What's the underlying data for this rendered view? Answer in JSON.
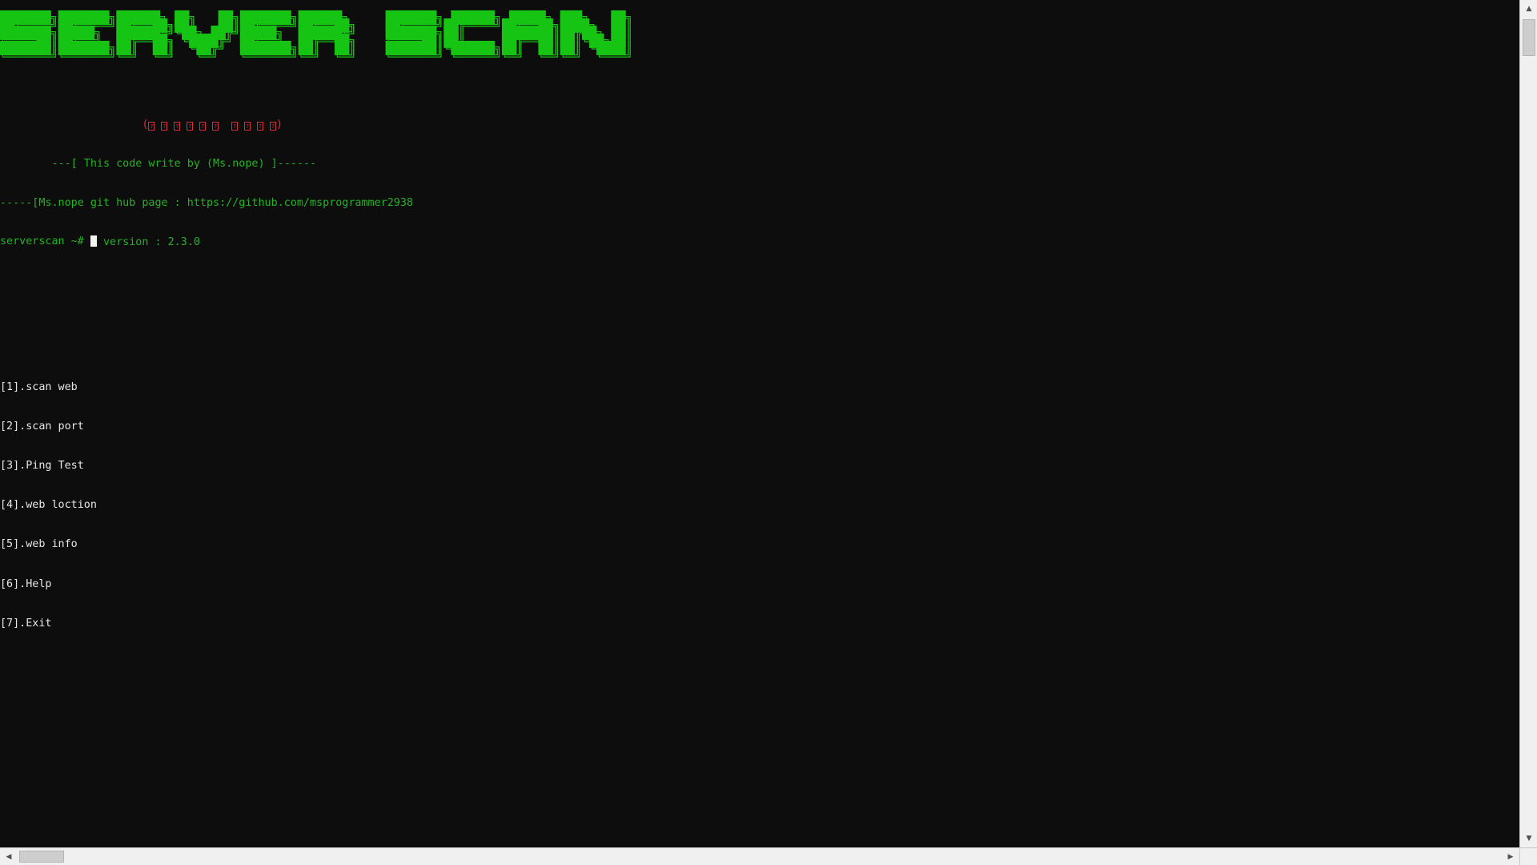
{
  "window": {
    "background_color": "#0d0d0d",
    "title": "serverscan"
  },
  "banner": {
    "name": "SERVER:SCAN",
    "color": "#16c413",
    "art": "███████╗███████╗██████╗ ██╗   ██╗███████╗██████╗     ███████╗ ██████╗ █████╗ ███╗   ██╗\n██╔════╝██╔════╝██╔══██╗██║   ██║██╔════╝██╔══██╗    ██╔════╝██╔════╝██╔══██╗████╗  ██║\n███████╗█████╗  ██████╔╝╚██╗ ██╔╝█████╗  ██████╔╝    ███████╗██║     ███████║██╔██╗ ██║\n╚════██║██╔══╝  ██╔══██╗ ╚████╔╝ ██╔══╝  ██╔══██╗    ╚════██║██║     ██╔══██║██║╚██╗██║\n███████║███████╗██║  ██║  ╚██╔╝  ███████╗██║  ██║    ███████║╚██████╗██║  ██║██║ ╚████║\n╚══════╝╚══════╝╚═╝  ╚═╝   ╚═╝   ╚══════╝╚═╝  ╚═╝    ╚══════╝ ╚═════╝╚═╝  ╚═╝╚═╝  ╚═══╝"
  },
  "header": {
    "subtitle_red": {
      "color": "#d32f3f",
      "leading_spaces": 14,
      "open_paren": "(",
      "close_paren": ")",
      "glyph_groups": [
        6,
        4
      ],
      "glyph_char": "?",
      "note": "unrenderable glyph boxes"
    },
    "credit_line": "        ---[ This code write by (Ms.nope) ]------",
    "github_line": "-----[Ms.nope git hub page : https://github.com/msprogrammer2938",
    "version_line": "                version : 2.3.0",
    "color": "#24b324"
  },
  "menu": {
    "color": "#e6e6e6",
    "items": [
      {
        "key": "1",
        "label": "[1].scan web"
      },
      {
        "key": "2",
        "label": "[2].scan port"
      },
      {
        "key": "3",
        "label": "[3].Ping Test"
      },
      {
        "key": "4",
        "label": "[4].web loction"
      },
      {
        "key": "5",
        "label": "[5].web info"
      },
      {
        "key": "6",
        "label": "[6].Help"
      },
      {
        "key": "7",
        "label": "[7].Exit"
      }
    ]
  },
  "prompt": {
    "text": "serverscan ~# ",
    "value": "",
    "color": "#24b324",
    "cursor": "block"
  },
  "scrollbars": {
    "vertical": {
      "up_arrow": "▲",
      "down_arrow": "▼"
    },
    "horizontal": {
      "left_arrow": "◀",
      "right_arrow": "▶"
    }
  }
}
